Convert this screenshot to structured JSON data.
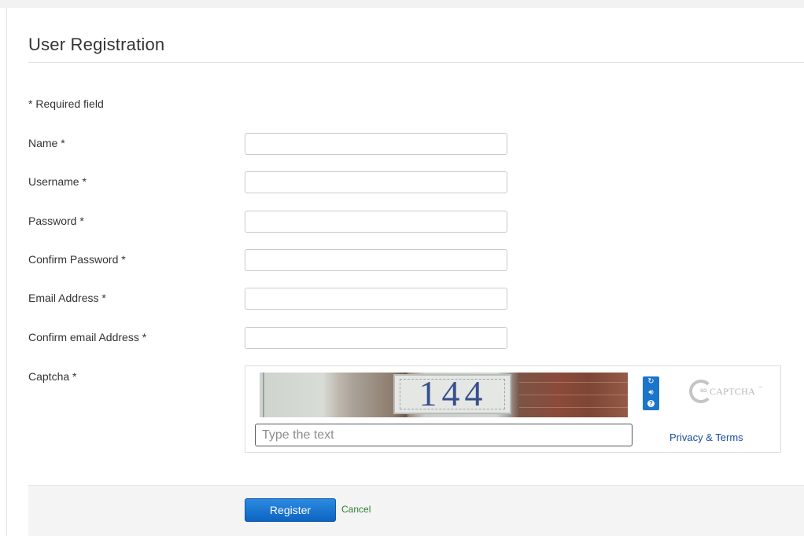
{
  "page": {
    "title": "User Registration",
    "required_note": "* Required field"
  },
  "form": {
    "fields": [
      {
        "label": "Name *",
        "value": "",
        "placeholder": ""
      },
      {
        "label": "Username *",
        "value": "",
        "placeholder": ""
      },
      {
        "label": "Password *",
        "value": "",
        "placeholder": ""
      },
      {
        "label": "Confirm Password *",
        "value": "",
        "placeholder": ""
      },
      {
        "label": "Email Address *",
        "value": "",
        "placeholder": ""
      },
      {
        "label": "Confirm email Address *",
        "value": "",
        "placeholder": ""
      }
    ],
    "captcha": {
      "label": "Captcha *",
      "image_text": "144",
      "input_placeholder": "Type the text",
      "input_value": "",
      "privacy_link": "Privacy & Terms",
      "logo": {
        "prefix": "SO",
        "word": "CAPTCHA",
        "mark": "™"
      },
      "controls": [
        "refresh-icon",
        "audio-icon",
        "help-icon"
      ]
    }
  },
  "actions": {
    "register_label": "Register",
    "cancel_label": "Cancel"
  },
  "colors": {
    "primary_button": "#0d64c2",
    "link_blue": "#1a4e9c",
    "cancel_green": "#2e7d32",
    "captcha_controls": "#1b75c9"
  }
}
